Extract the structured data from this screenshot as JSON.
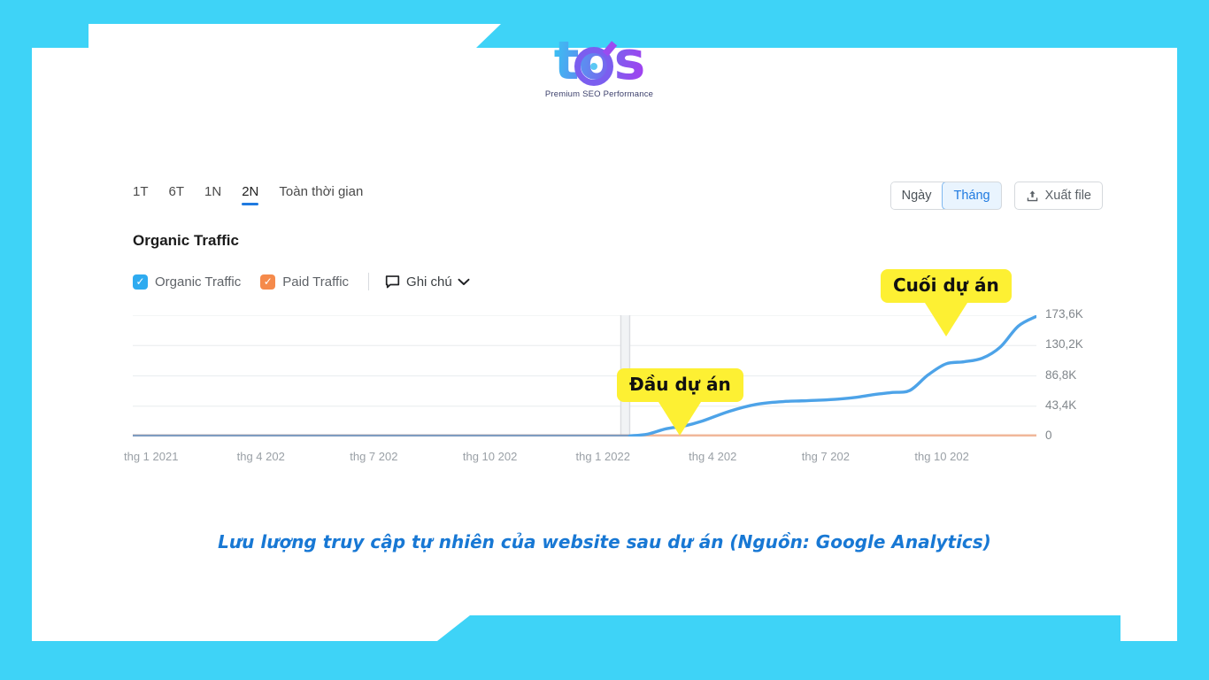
{
  "theme": {
    "background": "#3ed3f7",
    "card": "#ffffff",
    "accent_blue": "#1f7ae0",
    "organic_color": "#4da3e8",
    "paid_color": "#f0b79a",
    "highlight_yellow": "#fdf033",
    "caption_blue": "#1878d4"
  },
  "logo": {
    "wordmark": "tos",
    "tagline": "Premium SEO Performance",
    "icon": "target-ring-icon"
  },
  "toolbar": {
    "ranges": [
      {
        "label": "1T",
        "active": false
      },
      {
        "label": "6T",
        "active": false
      },
      {
        "label": "1N",
        "active": false
      },
      {
        "label": "2N",
        "active": true
      },
      {
        "label": "Toàn thời gian",
        "active": false
      }
    ],
    "granularity": [
      {
        "label": "Ngày",
        "active": false
      },
      {
        "label": "Tháng",
        "active": true
      }
    ],
    "export_label": "Xuất file",
    "export_icon": "upload-icon"
  },
  "chart_panel": {
    "title": "Organic Traffic",
    "legend": [
      {
        "label": "Organic Traffic",
        "checked": true,
        "color": "#2eabf0"
      },
      {
        "label": "Paid Traffic",
        "checked": true,
        "color": "#f58a4b"
      }
    ],
    "notes_label": "Ghi chú",
    "notes_icon": "speech-bubble-icon",
    "notes_chevron": "chevron-down-icon"
  },
  "annotations": [
    {
      "label": "Đầu dự án",
      "x_pct": 55.0
    },
    {
      "label": "Cuối dự án",
      "x_pct": 89.5
    }
  ],
  "caption": "Lưu lượng truy cập tự nhiên của website sau dự án (Nguồn: Google Analytics)",
  "chart_data": {
    "type": "line",
    "title": "Organic Traffic",
    "xlabel": "",
    "ylabel": "",
    "ylim": [
      0,
      173600
    ],
    "grid": true,
    "legend_position": "top-left",
    "ytick_labels": [
      "173,6K",
      "130,2K",
      "86,8K",
      "43,4K",
      "0"
    ],
    "ytick_values": [
      173600,
      130200,
      86800,
      43400,
      0
    ],
    "xtick_labels": [
      "thg 1 2021",
      "thg 4 202",
      "thg 7 202",
      "thg 10 202",
      "thg 1 2022",
      "thg 4 202",
      "thg 7 202",
      "thg 10 202"
    ],
    "series": [
      {
        "name": "Organic Traffic",
        "color": "#4da3e8",
        "x": [
          0,
          5,
          10,
          15,
          20,
          25,
          30,
          35,
          40,
          45,
          50,
          55,
          57,
          59,
          61,
          63,
          66,
          69,
          72,
          74,
          76,
          78,
          80,
          82,
          84,
          86,
          88,
          90,
          92,
          94,
          96,
          98,
          100
        ],
        "values": [
          900,
          900,
          900,
          900,
          900,
          900,
          900,
          900,
          900,
          900,
          900,
          900,
          3500,
          11000,
          15000,
          22000,
          36000,
          46000,
          50000,
          51000,
          52000,
          53500,
          56000,
          60000,
          63000,
          66000,
          88000,
          104000,
          107000,
          112000,
          128000,
          158000,
          172000
        ]
      },
      {
        "name": "Paid Traffic",
        "color": "#f0b79a",
        "x": [
          0,
          100
        ],
        "values": [
          0,
          0
        ]
      }
    ],
    "marker_line": {
      "x_pct": 54.5,
      "label": "project-start-marker"
    }
  }
}
